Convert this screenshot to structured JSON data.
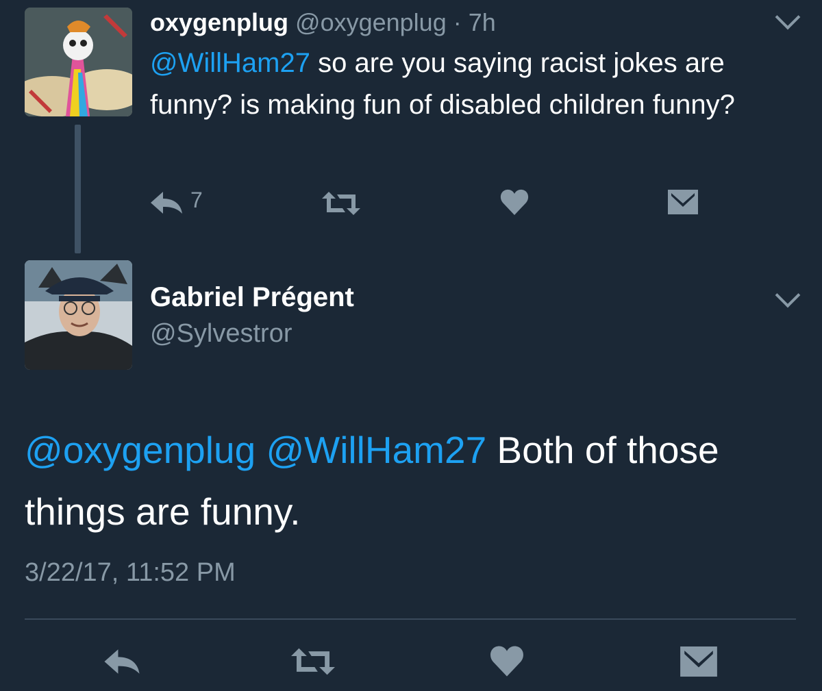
{
  "tweets": [
    {
      "display_name": "oxygenplug",
      "handle": "@oxygenplug",
      "separator": " · ",
      "time": "7h",
      "text_mention": "@WillHam27",
      "text_body": " so are you saying racist jokes are funny? is making fun of disabled children funny?",
      "reply_count": "7",
      "avatar_icon": "psychedelic-art-avatar"
    },
    {
      "display_name": "Gabriel Prégent",
      "handle": "@Sylvestror",
      "text_mention_1": "@oxygenplug",
      "text_mention_2": "@WillHam27",
      "text_body": " Both of those things are funny.",
      "timestamp": "3/22/17, 11:52 PM",
      "avatar_icon": "profile-photo-avatar"
    }
  ],
  "icons": {
    "reply": "reply-icon",
    "retweet": "retweet-icon",
    "like": "heart-icon",
    "dm": "envelope-icon",
    "menu": "chevron-down-icon"
  },
  "colors": {
    "background": "#1b2836",
    "mention": "#1da1f2",
    "secondary_text": "#8899a6",
    "action_icon": "#8899a6"
  }
}
